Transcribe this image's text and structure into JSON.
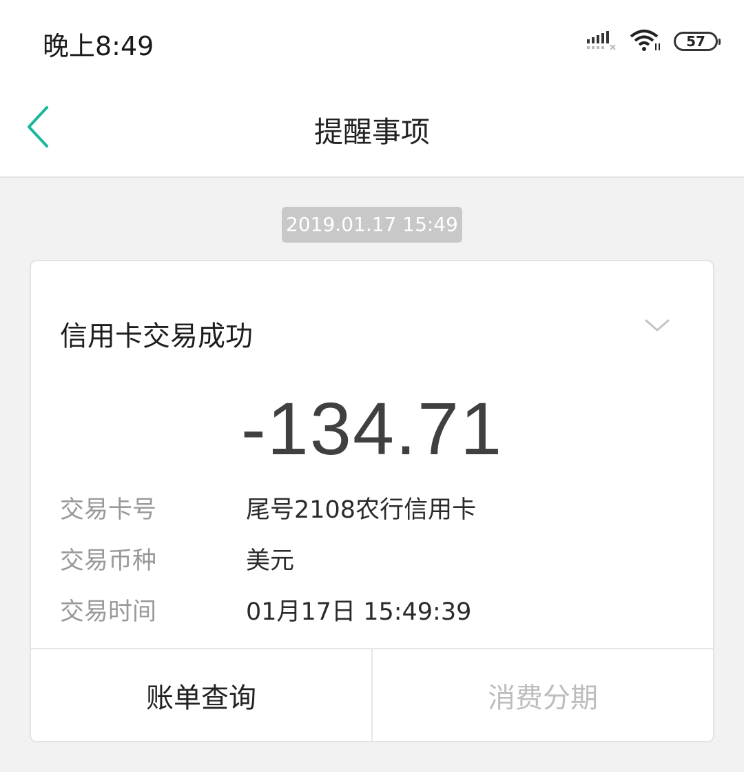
{
  "status_bar": {
    "time": "晚上8:49",
    "battery": "57",
    "icons": [
      "signal-icon",
      "wifi-icon",
      "battery-icon"
    ]
  },
  "header": {
    "title": "提醒事项",
    "back_icon": "chevron-left-icon",
    "accent_color": "#17b79a"
  },
  "message": {
    "timestamp": "2019.01.17 15:49",
    "card_title": "信用卡交易成功",
    "amount": "-134.71",
    "details": [
      {
        "label": "交易卡号",
        "value": "尾号2108农行信用卡"
      },
      {
        "label": "交易币种",
        "value": "美元"
      },
      {
        "label": "交易时间",
        "value": "01月17日 15:49:39"
      }
    ],
    "actions": {
      "bill_query": "账单查询",
      "installment": "消费分期"
    }
  }
}
